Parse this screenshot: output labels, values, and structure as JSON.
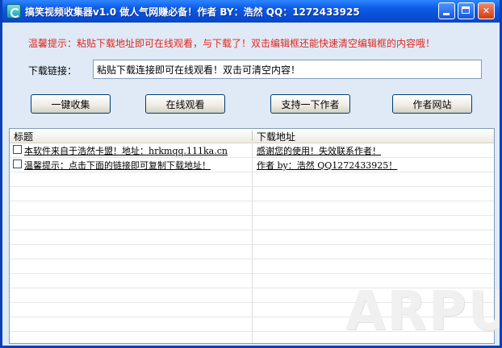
{
  "window": {
    "title": "搞笑视频收集器v1.0   做人气网赚必备！作者  BY：浩然   QQ：1272433925",
    "minimize_label": "",
    "maximize_label": "",
    "close_label": "✕"
  },
  "notice": "温馨提示：粘贴下载地址即可在线观看，与下载了！双击编辑框还能快速清空编辑框的内容哦！",
  "download": {
    "label": "下载链接：",
    "value": "粘贴下载连接即可在线观看！双击可清空内容！"
  },
  "buttons": {
    "collect": "一键收集",
    "watch": "在线观看",
    "support": "支持一下作者",
    "site": "作者网站"
  },
  "list": {
    "columns": [
      "标题",
      "下载地址"
    ],
    "rows": [
      {
        "title": "本软件来自于浩然卡盟！地址：hrkmqq.111ka.cn",
        "url": "感谢您的使用！失效联系作者！"
      },
      {
        "title": "温馨提示：点击下面的链接即可复制下载地址！",
        "url": "作者 by：浩然  QQ1272433925！"
      }
    ]
  },
  "watermark": "ARPUN",
  "icons": {
    "app": "app-icon",
    "minimize": "minimize-icon",
    "maximize": "maximize-icon",
    "close": "close-icon",
    "checkbox": "checkbox-icon"
  }
}
